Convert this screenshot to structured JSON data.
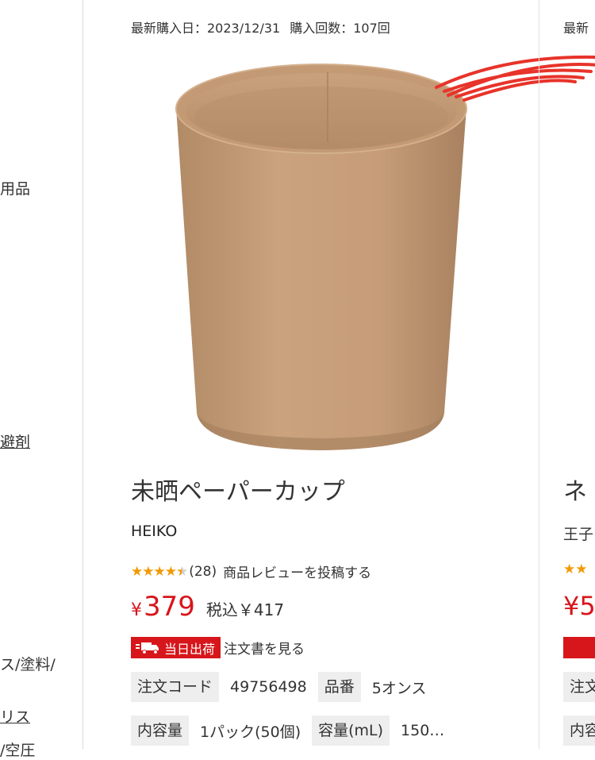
{
  "left_panel": {
    "fragments": [
      {
        "text": "用品",
        "underline": false
      },
      {
        "text": "避剤",
        "underline": true
      },
      {
        "text": "ス/塗料/",
        "underline": false
      },
      {
        "text": "リス",
        "underline": true
      },
      {
        "text": "/空圧",
        "underline": false
      }
    ]
  },
  "product": {
    "last_purchase_label": "最新購入日：2023/12/31",
    "purchase_count_label": "購入回数：107回",
    "image_icon": "kraft-paper-cup-image",
    "title": "未晒ペーパーカップ",
    "maker": "HEIKO",
    "rating": 4.5,
    "stars_text": "★★★★",
    "review_count": "(28)",
    "review_link": "商品レビューを投稿する",
    "yen_symbol": "¥",
    "price": "379",
    "tax_included": "税込￥417",
    "shipping_badge": "当日出荷",
    "order_sheet_link": "注文書を見る",
    "specs": [
      {
        "label": "注文コード",
        "value": "49756498"
      },
      {
        "label": "品番",
        "value": "5オンス"
      },
      {
        "label": "内容量",
        "value": "1パック(50個)"
      },
      {
        "label": "容量(mL)",
        "value": "150…"
      }
    ]
  },
  "next_card": {
    "meta_prefix": "最新",
    "title_char": "ネ",
    "maker_prefix": "王子",
    "stars": "★★",
    "price_prefix": "¥5",
    "spec1_prefix": "注文",
    "spec2_prefix": "内容"
  },
  "colors": {
    "accent_red": "#d7161b",
    "star_orange": "#f39800",
    "spec_label_bg": "#eeeeee"
  }
}
